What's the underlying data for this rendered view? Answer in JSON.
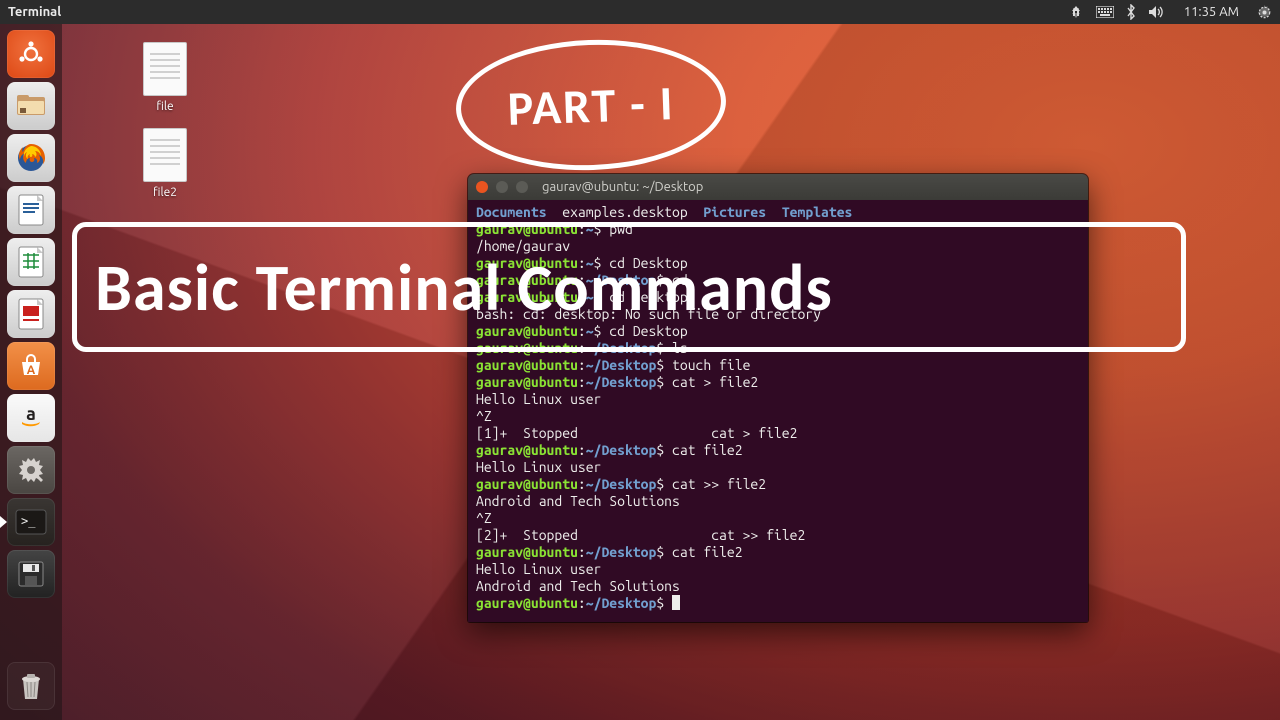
{
  "menubar": {
    "active_app": "Terminal",
    "time": "11:35 AM"
  },
  "desktop_icons": [
    {
      "label": "file"
    },
    {
      "label": "file2"
    }
  ],
  "launcher_items": [
    "dash",
    "files",
    "firefox",
    "libreoffice-writer",
    "libreoffice-calc",
    "libreoffice-impress",
    "software-center",
    "amazon",
    "settings",
    "terminal",
    "save"
  ],
  "overlay": {
    "bubble": "PART - I",
    "card": "Basic Terminal Commands"
  },
  "terminal": {
    "title": "gaurav@ubuntu: ~/Desktop",
    "prompt_user": "gaurav@ubuntu",
    "prompt_home": "~",
    "prompt_desk": "~/Desktop",
    "ls_dirs": [
      "Documents",
      "Pictures",
      "Templates"
    ],
    "ls_file": "examples.desktop",
    "lines": {
      "pwd_cmd": "pwd",
      "pwd_out": "/home/gaurav",
      "cd_desktop": "cd Desktop",
      "cd_plain": "cd",
      "cd_desktop2": "cd desktop",
      "err_cd": "bash: cd: desktop: No such file or directory",
      "cd_desktop3": "cd Desktop",
      "ls_cmd": "ls",
      "touch_cmd": "touch file",
      "catw_cmd": "cat > file2",
      "hello": "Hello Linux user",
      "ctrlz": "^Z",
      "stopped1": "[1]+  Stopped                 cat > file2",
      "catr_cmd": "cat file2",
      "cata_cmd": "cat >> file2",
      "android": "Android and Tech Solutions",
      "stopped2": "[2]+  Stopped                 cat >> file2",
      "catr2_cmd": "cat file2"
    }
  }
}
